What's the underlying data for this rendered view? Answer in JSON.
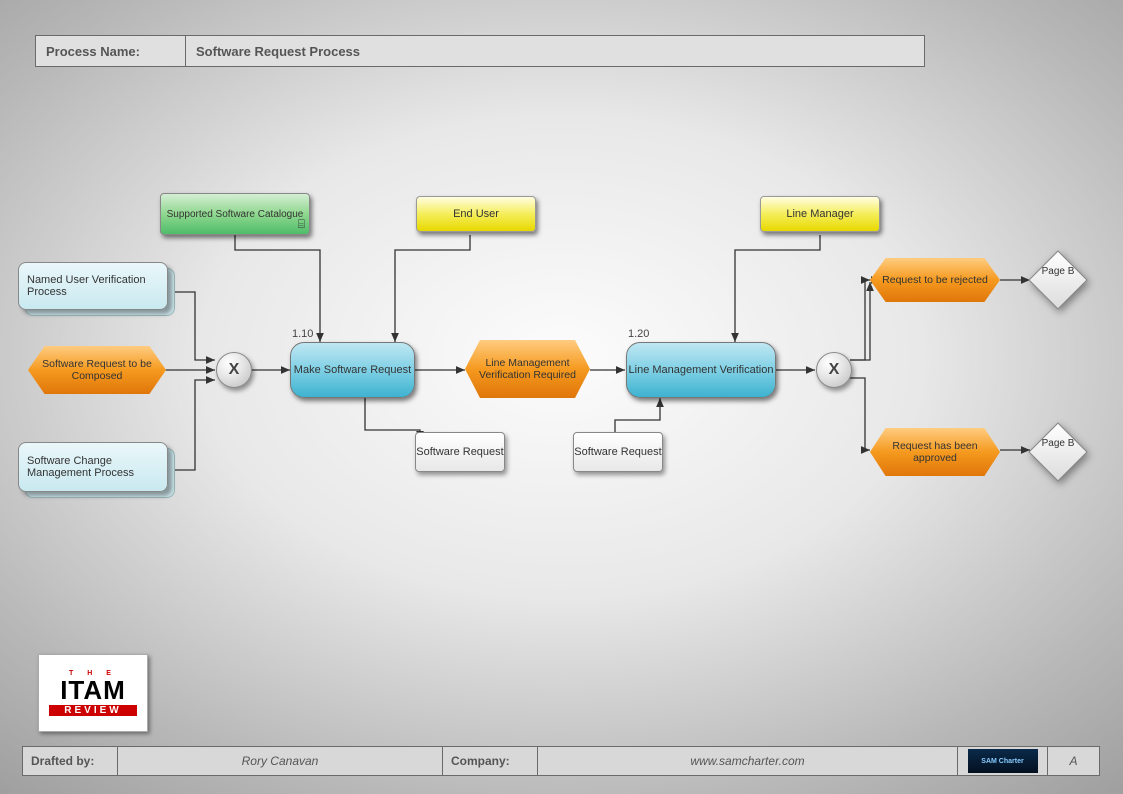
{
  "header": {
    "label": "Process Name:",
    "value": "Software Request Process"
  },
  "footer": {
    "drafted_label": "Drafted by:",
    "drafted_value": "Rory Canavan",
    "company_label": "Company:",
    "company_value": "www.samcharter.com",
    "logo_text": "SAM Charter",
    "page_id": "A"
  },
  "logo": {
    "top": "T H E",
    "mid": "ITAM",
    "bot": "REVIEW"
  },
  "nodes": {
    "catalogue": "Supported Software Catalogue",
    "end_user": "End User",
    "line_manager": "Line Manager",
    "named_user": "Named User Verification Process",
    "sw_change": "Software Change Management Process",
    "req_compose": "Software Request to be Composed",
    "make_req": "Make Software Request",
    "lm_verif_req": "Line Management Verification Required",
    "lm_verif": "Line Management Verification",
    "req_rejected": "Request to be rejected",
    "req_approved": "Request has been approved",
    "sw_request1": "Software Request",
    "sw_request2": "Software Request",
    "page_b1": "Page B",
    "page_b2": "Page B",
    "gateway": "X",
    "step1": "1.10",
    "step2": "1.20"
  }
}
